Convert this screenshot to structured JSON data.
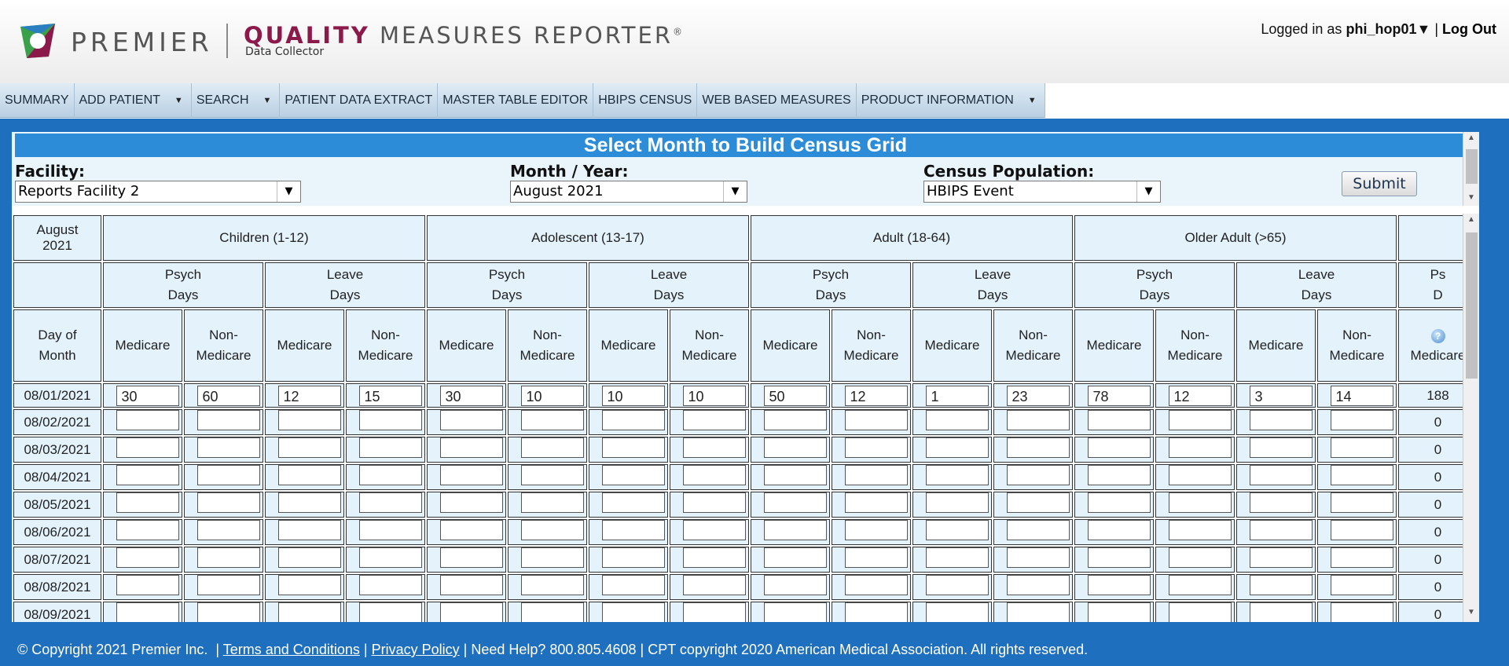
{
  "header": {
    "brand": "PREMIER",
    "product_quality": "QUALITY",
    "product_rest": "MEASURES REPORTER",
    "registered": "®",
    "subtitle": "Data Collector",
    "logged_in_prefix": "Logged in as",
    "username": "phi_hop01",
    "username_caret": "▼",
    "separator": "|",
    "logout": "Log Out"
  },
  "nav": {
    "items": [
      {
        "label": "SUMMARY",
        "caret": ""
      },
      {
        "label": "ADD PATIENT",
        "caret": "▼"
      },
      {
        "label": "SEARCH",
        "caret": "▼"
      },
      {
        "label": "PATIENT DATA EXTRACT",
        "caret": ""
      },
      {
        "label": "MASTER TABLE EDITOR",
        "caret": ""
      },
      {
        "label": "HBIPS CENSUS",
        "caret": ""
      },
      {
        "label": "WEB BASED MEASURES",
        "caret": ""
      },
      {
        "label": "PRODUCT INFORMATION",
        "caret": "▼"
      }
    ]
  },
  "form": {
    "title": "Select Month to Build Census Grid",
    "facility_label": "Facility:",
    "facility_value": "Reports Facility 2",
    "month_label": "Month / Year:",
    "month_value": "August 2021",
    "population_label": "Census Population:",
    "population_value": "HBIPS Event",
    "submit_label": "Submit"
  },
  "grid": {
    "month_header": [
      "August",
      "2021"
    ],
    "age_groups": [
      "Children (1-12)",
      "Adolescent (13-17)",
      "Adult (18-64)",
      "Older Adult (>65)"
    ],
    "day_types": [
      [
        "Psych",
        "Days"
      ],
      [
        "Leave",
        "Days"
      ]
    ],
    "partial_day_type": [
      "Ps",
      "D"
    ],
    "day_of_month_label": [
      "Day of",
      "Month"
    ],
    "medicare_label": "Medicare",
    "non_medicare_label": [
      "Non-",
      "Medicare"
    ],
    "help_icon_glyph": "?",
    "rows": [
      {
        "date": "08/01/2021",
        "values": [
          "30",
          "60",
          "12",
          "15",
          "30",
          "10",
          "10",
          "10",
          "50",
          "12",
          "1",
          "23",
          "78",
          "12",
          "3",
          "14"
        ],
        "total": "188"
      },
      {
        "date": "08/02/2021",
        "values": [
          "",
          "",
          "",
          "",
          "",
          "",
          "",
          "",
          "",
          "",
          "",
          "",
          "",
          "",
          "",
          ""
        ],
        "total": "0"
      },
      {
        "date": "08/03/2021",
        "values": [
          "",
          "",
          "",
          "",
          "",
          "",
          "",
          "",
          "",
          "",
          "",
          "",
          "",
          "",
          "",
          ""
        ],
        "total": "0"
      },
      {
        "date": "08/04/2021",
        "values": [
          "",
          "",
          "",
          "",
          "",
          "",
          "",
          "",
          "",
          "",
          "",
          "",
          "",
          "",
          "",
          ""
        ],
        "total": "0"
      },
      {
        "date": "08/05/2021",
        "values": [
          "",
          "",
          "",
          "",
          "",
          "",
          "",
          "",
          "",
          "",
          "",
          "",
          "",
          "",
          "",
          ""
        ],
        "total": "0"
      },
      {
        "date": "08/06/2021",
        "values": [
          "",
          "",
          "",
          "",
          "",
          "",
          "",
          "",
          "",
          "",
          "",
          "",
          "",
          "",
          "",
          ""
        ],
        "total": "0"
      },
      {
        "date": "08/07/2021",
        "values": [
          "",
          "",
          "",
          "",
          "",
          "",
          "",
          "",
          "",
          "",
          "",
          "",
          "",
          "",
          "",
          ""
        ],
        "total": "0"
      },
      {
        "date": "08/08/2021",
        "values": [
          "",
          "",
          "",
          "",
          "",
          "",
          "",
          "",
          "",
          "",
          "",
          "",
          "",
          "",
          "",
          ""
        ],
        "total": "0"
      },
      {
        "date": "08/09/2021",
        "values": [
          "",
          "",
          "",
          "",
          "",
          "",
          "",
          "",
          "",
          "",
          "",
          "",
          "",
          "",
          "",
          ""
        ],
        "total": "0"
      }
    ]
  },
  "footer": {
    "copyright": "© Copyright 2021 Premier Inc.",
    "terms": "Terms and Conditions",
    "privacy": "Privacy Policy",
    "help": "Need Help? 800.805.4608",
    "cpt": "CPT copyright 2020 American Medical Association. All rights reserved.",
    "sep": "|"
  },
  "colors": {
    "accent_blue": "#1f6fbf",
    "title_bar": "#2d8cd8",
    "cell_bg": "#e3f2fb",
    "brand_maroon": "#8b1a4a"
  }
}
